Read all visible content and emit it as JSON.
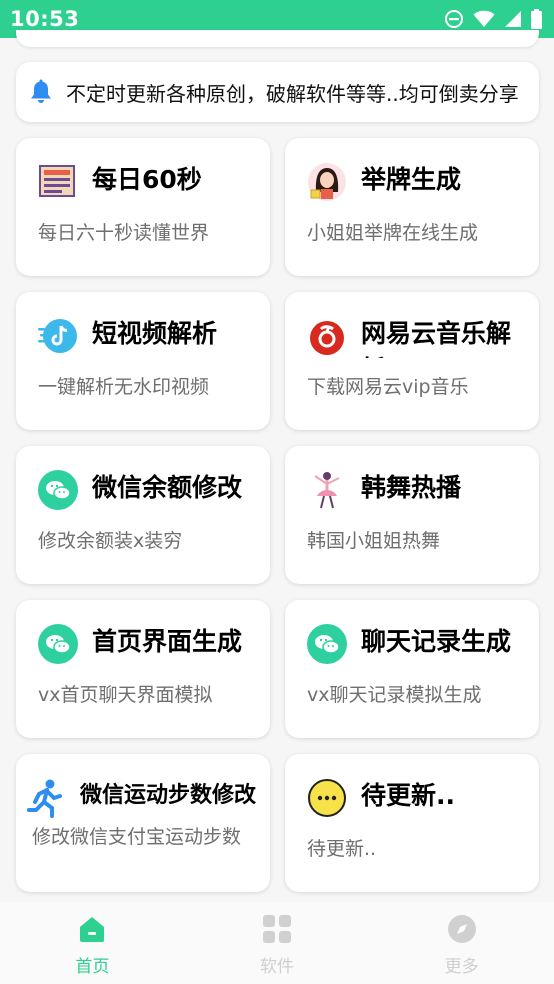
{
  "status_bar": {
    "time": "10:53",
    "icons": [
      "do-not-disturb-icon",
      "wifi-icon",
      "signal-icon",
      "battery-icon"
    ]
  },
  "notice": {
    "icon": "bell-icon",
    "text": "不定时更新各种原创，破解软件等等..均可倒卖分享"
  },
  "cards": [
    {
      "title": "每日60秒",
      "desc": "每日六十秒读懂世界",
      "icon": "newspaper-icon"
    },
    {
      "title": "举牌生成",
      "desc": "小姐姐举牌在线生成",
      "icon": "girl-avatar-icon"
    },
    {
      "title": "短视频解析",
      "desc": "一键解析无水印视频",
      "icon": "tiktok-icon"
    },
    {
      "title": "网易云音乐解析",
      "desc": "下载网易云vip音乐",
      "icon": "netease-music-icon"
    },
    {
      "title": "微信余额修改",
      "desc": "修改余额装x装穷",
      "icon": "wechat-icon"
    },
    {
      "title": "韩舞热播",
      "desc": "韩国小姐姐热舞",
      "icon": "dancer-icon"
    },
    {
      "title": "首页界面生成",
      "desc": "vx首页聊天界面模拟",
      "icon": "wechat-icon"
    },
    {
      "title": "聊天记录生成",
      "desc": "vx聊天记录模拟生成",
      "icon": "wechat-icon"
    },
    {
      "title": "微信运动步数修改",
      "desc": "修改微信支付宝运动步数",
      "icon": "runner-icon"
    },
    {
      "title": "待更新..",
      "desc": "待更新..",
      "icon": "smiley-icon"
    }
  ],
  "tabbar": {
    "tabs": [
      {
        "label": "首页",
        "icon": "home-icon",
        "active": true
      },
      {
        "label": "软件",
        "icon": "grid-icon",
        "active": false
      },
      {
        "label": "更多",
        "icon": "compass-icon",
        "active": false
      }
    ]
  },
  "colors": {
    "accent": "#2ed08f",
    "inactive_tab": "#d0d0d0",
    "bell": "#2f8cf0",
    "wechat": "#2ed0a0",
    "netease": "#d8291f"
  }
}
